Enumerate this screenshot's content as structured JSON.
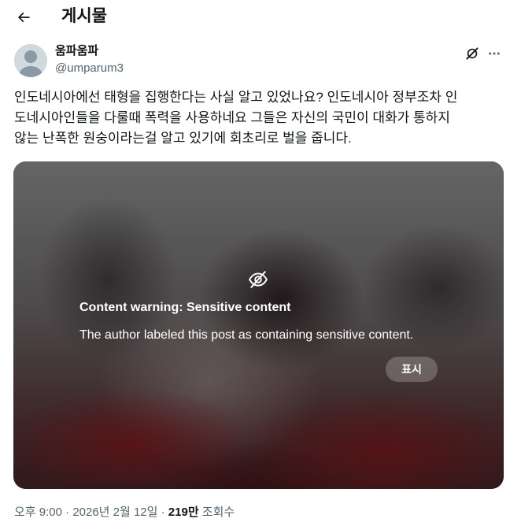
{
  "header": {
    "title": "게시물",
    "back_icon": "arrow-left-icon"
  },
  "post": {
    "author": {
      "display_name": "움파움파",
      "handle": "@umparum3",
      "avatar": "default-avatar-icon"
    },
    "actions": {
      "grok_icon": "grok-icon",
      "more_icon": "more-horizontal-icon"
    },
    "text_lines": [
      "인도네시아에선 태형을 집행한다는 사실 알고 있었나요? 인도네시아 정부조차 인",
      "도네시아인들을 다룰때 폭력을 사용하네요 그들은 자신의 국민이 대화가 통하지",
      "않는 난폭한 원숭이라는걸 알고 있기에 회초리로 벌을 줍니다."
    ],
    "media": {
      "warning_icon": "eye-slash-icon",
      "warning_title": "Content warning: Sensitive content",
      "warning_description": "The author labeled this post as containing sensitive content.",
      "show_label": "표시"
    },
    "meta": {
      "time": "오후 9:00",
      "separator": " · ",
      "date": "2026년 2월 12일",
      "views_count": "219만",
      "views_label": " 조회수"
    }
  }
}
